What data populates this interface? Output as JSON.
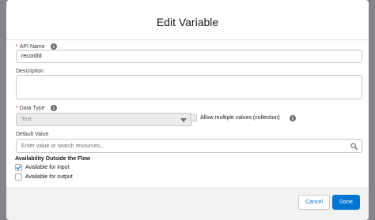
{
  "modal": {
    "title": "Edit Variable"
  },
  "api_name": {
    "required_mark": "*",
    "label": "API Name",
    "value": "recordId"
  },
  "description": {
    "label": "Description",
    "value": ""
  },
  "data_type": {
    "required_mark": "*",
    "label": "Data Type",
    "value": "Text"
  },
  "allow_multiple": {
    "label": "Allow multiple values (collection)",
    "checked": false
  },
  "default_value": {
    "label": "Default Value",
    "placeholder": "Enter value or search resources..."
  },
  "availability": {
    "title": "Availability Outside the Flow",
    "options": [
      {
        "label": "Available for input",
        "checked": true
      },
      {
        "label": "Available for output",
        "checked": false
      }
    ]
  },
  "footer": {
    "cancel_label": "Cancel",
    "done_label": "Done"
  },
  "colors": {
    "brand": "#0176d3",
    "required": "#c23934",
    "backdrop": "#838588"
  },
  "icons": {
    "info": "info-icon",
    "select": "chevron-down-icon",
    "search": "search-icon",
    "check": "checkmark-icon"
  }
}
